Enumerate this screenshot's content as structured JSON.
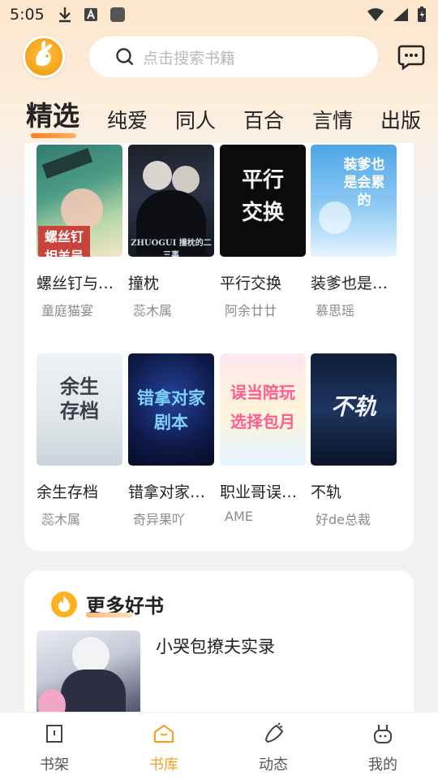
{
  "status_bar": {
    "time": "5:05"
  },
  "search": {
    "placeholder": "点击搜索书籍"
  },
  "tabs": [
    {
      "label": "精选",
      "active": true
    },
    {
      "label": "纯爱",
      "active": false
    },
    {
      "label": "同人",
      "active": false
    },
    {
      "label": "百合",
      "active": false
    },
    {
      "label": "言情",
      "active": false
    },
    {
      "label": "出版",
      "active": false
    }
  ],
  "books_row1": [
    {
      "title": "螺丝钉与…",
      "author": "童庭猫宴",
      "cover_text": "螺丝钉 相羊吴"
    },
    {
      "title": "撞枕",
      "author": "蕊木属",
      "cover_text": "ZHUOGUI 撞枕的二三事"
    },
    {
      "title": "平行交换",
      "author": "阿余廿廿",
      "cover_text": "平行交换"
    },
    {
      "title": "装爹也是…",
      "author": "慕思瑶",
      "cover_text": "装爹也是会累的"
    }
  ],
  "books_row2": [
    {
      "title": "余生存档",
      "author": "蕊木属",
      "cover_text": "余生存档"
    },
    {
      "title": "错拿对家…",
      "author": "奇异果吖",
      "cover_text": "错拿对家剧本"
    },
    {
      "title": "职业哥误…",
      "author": "AME",
      "cover_text": "误当陪玩 选择包月"
    },
    {
      "title": "不轨",
      "author": "好de总裁",
      "cover_text": "不轨"
    }
  ],
  "more_section": {
    "title": "更多好书",
    "book": {
      "title": "小哭包撩夫实录"
    }
  },
  "bottom_nav": [
    {
      "label": "书架",
      "icon": "bookshelf-icon",
      "active": false
    },
    {
      "label": "书库",
      "icon": "library-icon",
      "active": true
    },
    {
      "label": "动态",
      "icon": "feed-icon",
      "active": false
    },
    {
      "label": "我的",
      "icon": "profile-icon",
      "active": false
    }
  ],
  "colors": {
    "accent": "#f2a12b",
    "tab_underline": "#ff7a1c",
    "header_bg": "#fde6cc"
  }
}
